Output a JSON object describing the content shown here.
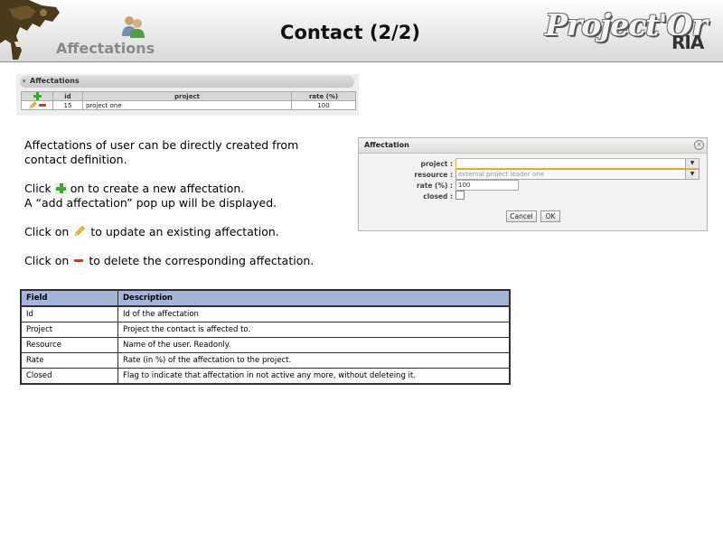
{
  "header": {
    "section_label": "Affectations",
    "title": "Contact (2/2)",
    "brand_main": "Project'Or",
    "brand_sub": "RIA"
  },
  "affectations_panel": {
    "title": "Affectations",
    "columns": [
      "id",
      "project",
      "rate (%)"
    ],
    "rows": [
      {
        "id": "15",
        "project": "project one",
        "rate": "100"
      }
    ]
  },
  "instructions": {
    "line1": "Affectations of user can be directly created from",
    "line2": "contact definition.",
    "click_create_pre": "Click",
    "click_create_post": "on to create a new affectation.",
    "popup_text": "A “add affectation” pop up will be displayed.",
    "click_update_pre": "Click on",
    "click_update_post": "to update an existing affectation.",
    "click_delete_pre": "Click on",
    "click_delete_post": "to delete the corresponding affectation."
  },
  "dialog": {
    "title": "Affectation",
    "project_label": "project :",
    "project_value": "",
    "resource_label": "resource :",
    "resource_value": "external project leader one",
    "rate_label": "rate (%) :",
    "rate_value": "100",
    "closed_label": "closed :",
    "cancel_label": "Cancel",
    "ok_label": "OK"
  },
  "fields_table": {
    "headers": [
      "Field",
      "Description"
    ],
    "rows": [
      {
        "field": "Id",
        "description": "Id of the affectation"
      },
      {
        "field": "Project",
        "description": "Project the contact  is affected to."
      },
      {
        "field": "Resource",
        "description": "Name of the user. Readonly."
      },
      {
        "field": "Rate",
        "description": "Rate (in %) of the affectation to the project."
      },
      {
        "field": "Closed",
        "description": "Flag to indicate that affectation in not active any more, without deleteing it."
      }
    ]
  },
  "colors": {
    "table_header_bg": "#a5b4d8",
    "add_green": "#3aaa2a",
    "delete_red": "#e2301a",
    "focus_border": "#e3b04a"
  },
  "icons": [
    "project-logo-icon",
    "affectations-users-icon",
    "add-icon",
    "edit-pencil-icon",
    "delete-minus-icon",
    "close-icon",
    "dropdown-arrow-icon"
  ]
}
